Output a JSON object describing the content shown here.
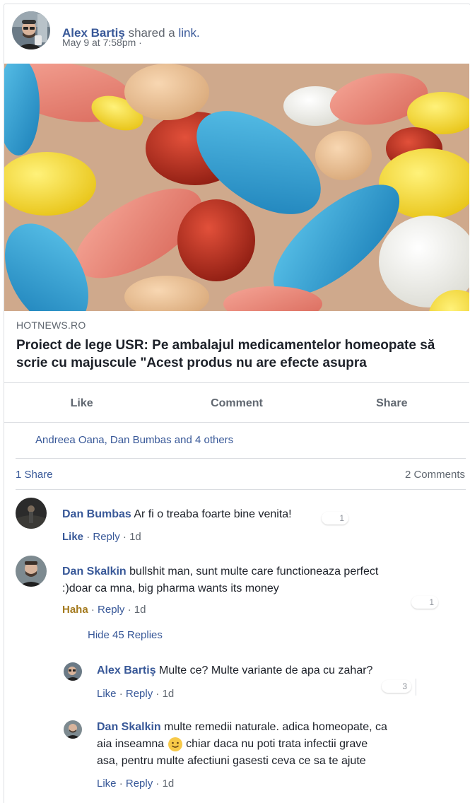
{
  "post": {
    "author": "Alex Bartiş",
    "shared_text": "shared a",
    "shared_link_text": "link.",
    "timestamp": "May 9 at 7:58pm ·",
    "preview": {
      "source": "HOTNEWS.RO",
      "title": "Proiect de lege USR: Pe ambalajul medicamentelor homeopate să scrie cu majuscule \"Acest produs nu are efecte asupra"
    },
    "actions": {
      "like": "Like",
      "comment": "Comment",
      "share": "Share"
    },
    "reactions_summary": "Andreea Oana, Dan Bumbas and 4 others",
    "shares_count": "1 Share",
    "comments_count": "2 Comments"
  },
  "comments": [
    {
      "author": "Dan Bumbas",
      "text": "Ar fi o treaba foarte bine venita!",
      "reaction_label": "Like",
      "reply_label": "Reply",
      "age": "1d",
      "reactions_count": "1"
    },
    {
      "author": "Dan Skalkin",
      "text_line1": "bullshit man, sunt multe care functioneaza perfect",
      "text_line2": ":)doar ca mna, big pharma wants its money",
      "reaction_label": "Haha",
      "reply_label": "Reply",
      "age": "1d",
      "reactions_count": "1",
      "hide_replies": "Hide 45 Replies",
      "replies": [
        {
          "author": "Alex Bartiş",
          "text": "Multe ce? Multe variante de apa cu zahar?",
          "reaction_label": "Like",
          "reply_label": "Reply",
          "age": "1d",
          "reactions_count": "3"
        },
        {
          "author": "Dan Skalkin",
          "text_part1": "multe remedii naturale. adica homeopate, ca",
          "text_part2": "aia inseamna",
          "text_part3": "chiar daca nu poti trata infectii grave",
          "text_line3": "asa, pentru multe afectiuni gasesti ceva ce sa te ajute",
          "reaction_label": "Like",
          "reply_label": "Reply",
          "age": "1d"
        }
      ]
    }
  ],
  "separators": {
    "dot": "·"
  },
  "colors": {
    "link_blue": "#385898",
    "meta_gray": "#606770",
    "haha_gold": "#a47a1e",
    "divider": "#dadde1"
  },
  "icons": {
    "smiley": "slightly-smiling-face-emoji"
  }
}
